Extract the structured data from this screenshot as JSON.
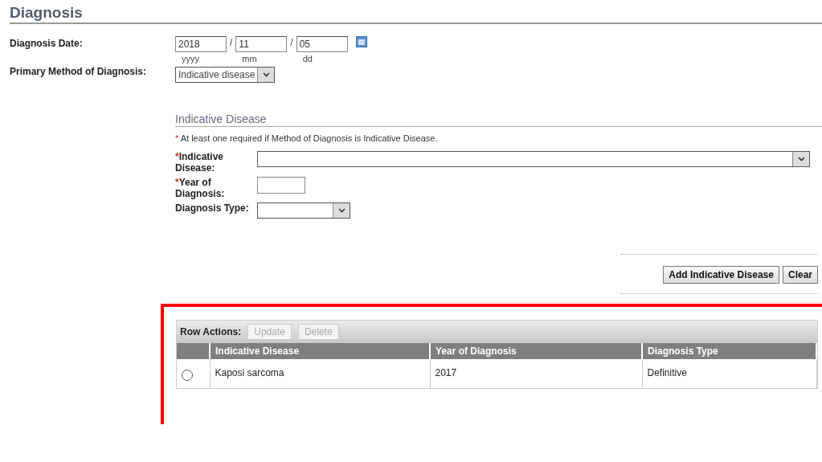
{
  "section_title": "Diagnosis",
  "diagnosis_date": {
    "label": "Diagnosis Date:",
    "year": "2018",
    "month": "11",
    "day": "05",
    "separator": "/",
    "hints": [
      "yyyy",
      "mm",
      "dd"
    ]
  },
  "primary_method": {
    "label": "Primary Method of Diagnosis:",
    "value": "Indicative disease"
  },
  "indicative_disease": {
    "title": "Indicative Disease",
    "note_mark": "*",
    "note": "At least one required if Method of Diagnosis is Indicative Disease.",
    "fields": [
      {
        "kind": "wide-select",
        "required_mark": "*",
        "label": "Indicative Disease:"
      },
      {
        "kind": "text",
        "required_mark": "*",
        "label": "Year of Diagnosis:"
      },
      {
        "kind": "select",
        "label": "Diagnosis Type:"
      }
    ],
    "buttons": [
      "Add Indicative Disease",
      "Clear"
    ]
  },
  "grid": {
    "row_actions_label": "Row Actions:",
    "row_actions": [
      {
        "label": "Update",
        "disabled": true
      },
      {
        "label": "Delete",
        "disabled": true
      }
    ],
    "columns": [
      "Indicative Disease",
      "Year of Diagnosis",
      "Diagnosis Type"
    ],
    "rows": [
      {
        "selected": false,
        "cells": [
          "Kaposi sarcoma",
          "2017",
          "Definitive"
        ]
      }
    ]
  }
}
